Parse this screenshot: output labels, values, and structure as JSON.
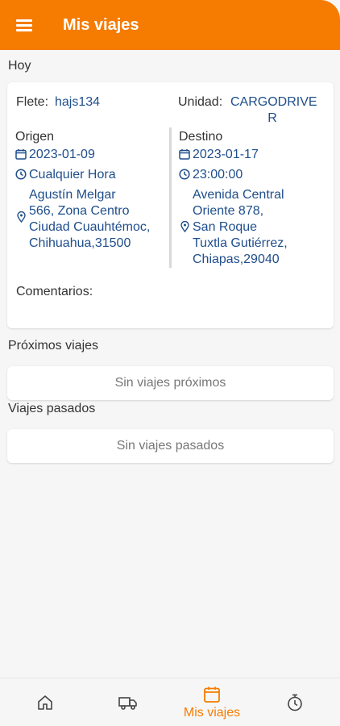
{
  "header": {
    "title": "Mis viajes",
    "menu_icon": "hamburger-menu-icon"
  },
  "today": {
    "label": "Hoy",
    "trip": {
      "flete_label": "Flete:",
      "flete_value": "hajs134",
      "unidad_label": "Unidad:",
      "unidad_value_line1": "CARGODRIVE",
      "unidad_value_line2": "R",
      "origin": {
        "label": "Origen",
        "date": "2023-01-09",
        "time": "Cualquier Hora",
        "address_lines": [
          "Agustín Melgar",
          "566, Zona Centro",
          "Ciudad Cuauhtémoc,",
          "Chihuahua,31500"
        ]
      },
      "destination": {
        "label": "Destino",
        "date": "2023-01-17",
        "time": "23:00:00",
        "address_lines": [
          "Avenida Central",
          "Oriente 878,",
          "San Roque",
          "Tuxtla Gutiérrez,",
          "Chiapas,29040"
        ]
      },
      "comments_label": "Comentarios:"
    }
  },
  "upcoming": {
    "label": "Próximos viajes",
    "empty_text": "Sin viajes próximos"
  },
  "past": {
    "label": "Viajes pasados",
    "empty_text": "Sin viajes pasados"
  },
  "bottom_nav": {
    "items": [
      {
        "icon": "home-icon",
        "label": ""
      },
      {
        "icon": "truck-icon",
        "label": ""
      },
      {
        "icon": "calendar-icon",
        "label": "Mis viajes",
        "active": true
      },
      {
        "icon": "stopwatch-icon",
        "label": ""
      }
    ]
  },
  "colors": {
    "primary": "#f57c00",
    "value_text": "#1f4e8c",
    "background": "#f6f6f6"
  }
}
